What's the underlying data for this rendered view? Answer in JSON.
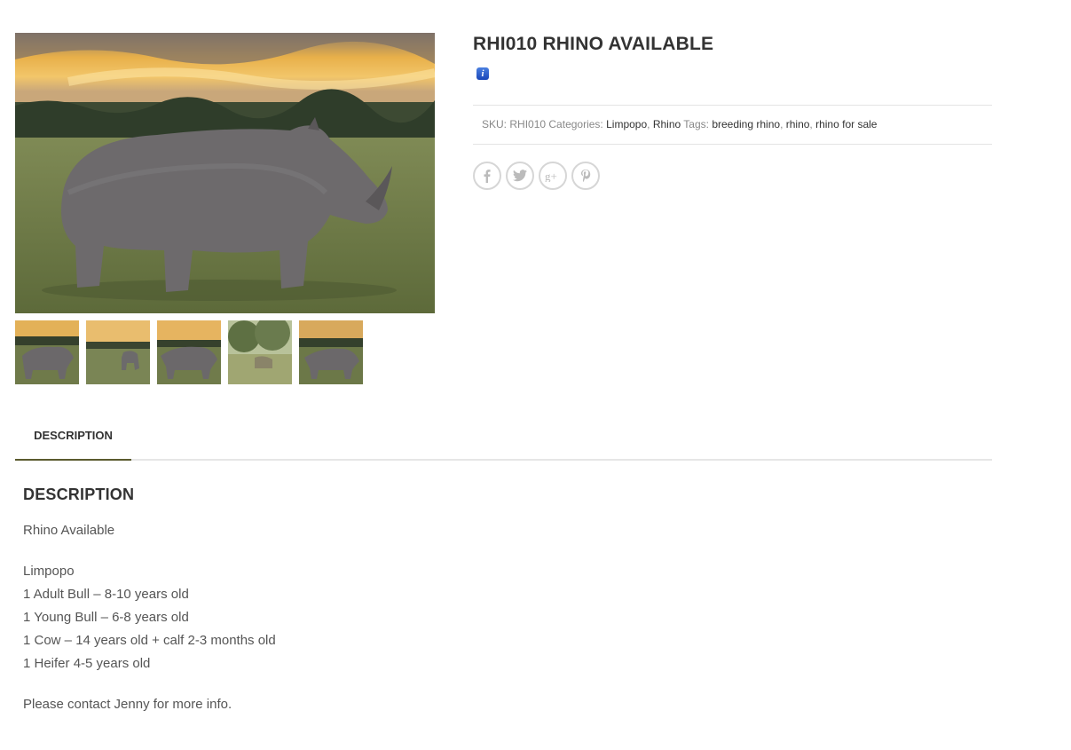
{
  "product": {
    "title": "RHI010 RHINO AVAILABLE",
    "info_icon": "info-icon",
    "meta": {
      "sku_label": "SKU:",
      "sku_value": "RHI010",
      "categories_label": "Categories:",
      "categories": [
        "Limpopo",
        "Rhino"
      ],
      "tags_label": "Tags:",
      "tags": [
        "breeding rhino",
        "rhino",
        "rhino for sale"
      ]
    },
    "share": [
      "facebook-icon",
      "twitter-icon",
      "google-plus-icon",
      "pinterest-icon"
    ]
  },
  "gallery": {
    "main": "rhino-sunset-photo",
    "thumbnails": [
      "rhino-sunset-thumb-1",
      "rhino-sunset-thumb-2",
      "rhino-sunset-thumb-3",
      "rhino-bush-thumb-4",
      "rhino-sunset-thumb-5"
    ]
  },
  "tabs": [
    {
      "label": "DESCRIPTION",
      "active": true
    }
  ],
  "description": {
    "heading": "DESCRIPTION",
    "intro": "Rhino Available",
    "lines": [
      "Limpopo",
      "1 Adult Bull – 8-10 years old",
      "1 Young Bull – 6-8 years old",
      "1 Cow – 14 years old + calf 2-3 months old",
      "1 Heifer 4-5 years old"
    ],
    "contact": "Please contact Jenny for more info."
  },
  "colors": {
    "title": "#333333",
    "active_tab_underline": "#5a5a2e",
    "info_icon": "#1a47b8"
  }
}
